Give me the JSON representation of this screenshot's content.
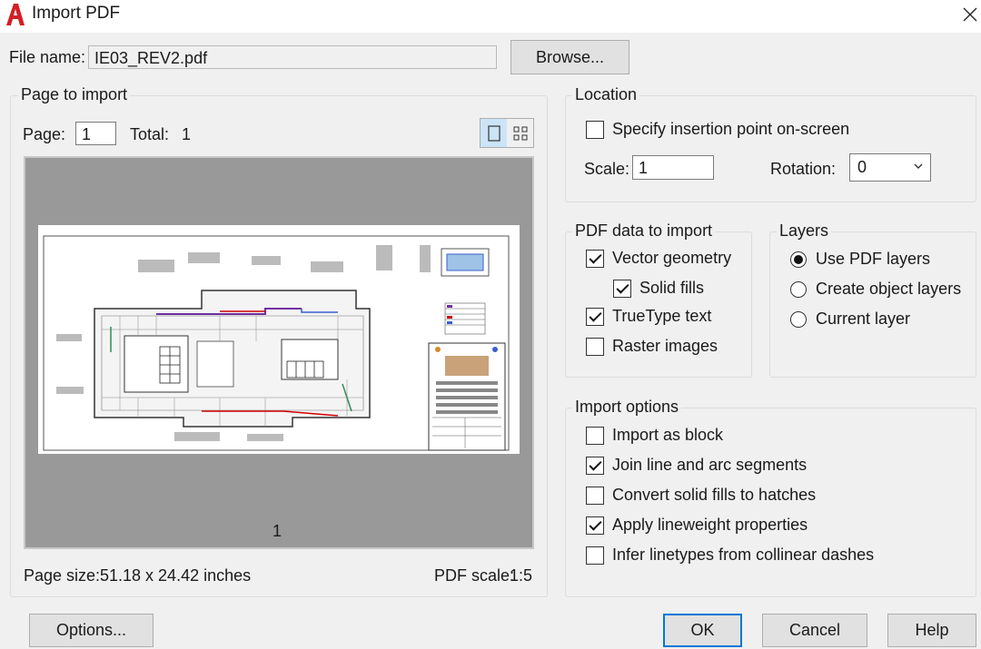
{
  "window": {
    "title": "Import PDF"
  },
  "file": {
    "label": "File name:",
    "value": "IE03_REV2.pdf",
    "browse_label": "Browse..."
  },
  "page_to_import": {
    "legend": "Page to import",
    "page_label": "Page:",
    "page_value": "1",
    "total_label": "Total:",
    "total_value": "1",
    "preview_page_number": "1",
    "page_size_label": "Page size:",
    "page_size_value": "51.18 x 24.42 inches",
    "pdf_scale_label": "PDF scale:",
    "pdf_scale_value": "1:5"
  },
  "location": {
    "legend": "Location",
    "specify_label": "Specify insertion point on-screen",
    "specify_checked": false,
    "scale_label": "Scale:",
    "scale_value": "1",
    "rotation_label": "Rotation:",
    "rotation_value": "0"
  },
  "pdf_data": {
    "legend": "PDF data to import",
    "vector_label": "Vector geometry",
    "vector_checked": true,
    "solid_fills_label": "Solid fills",
    "solid_fills_checked": true,
    "truetype_label": "TrueType text",
    "truetype_checked": true,
    "raster_label": "Raster images",
    "raster_checked": false
  },
  "layers": {
    "legend": "Layers",
    "options": [
      "Use PDF layers",
      "Create object layers",
      "Current layer"
    ],
    "selected": 0
  },
  "import_options": {
    "legend": "Import options",
    "items": [
      {
        "label": "Import as block",
        "checked": false
      },
      {
        "label": "Join line and arc segments",
        "checked": true
      },
      {
        "label": "Convert solid fills to hatches",
        "checked": false
      },
      {
        "label": "Apply lineweight properties",
        "checked": true
      },
      {
        "label": "Infer linetypes from collinear dashes",
        "checked": false
      }
    ]
  },
  "buttons": {
    "options": "Options...",
    "ok": "OK",
    "cancel": "Cancel",
    "help": "Help"
  },
  "colors": {
    "accent": "#0078d7",
    "app_icon": "#d31f26",
    "preview_bg": "#999999"
  }
}
